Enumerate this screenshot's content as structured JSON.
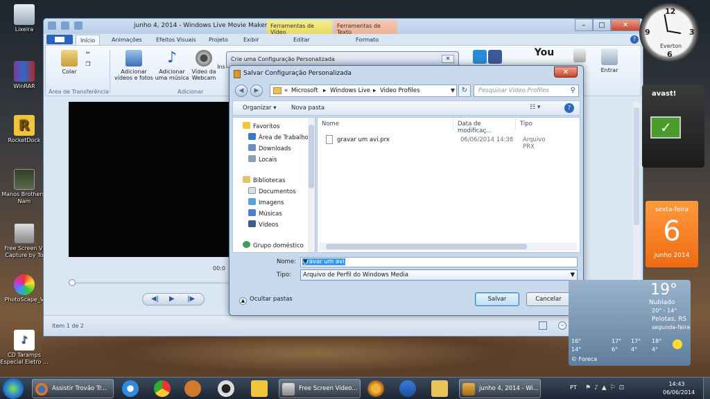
{
  "desktop_icons": [
    {
      "label": "Lixeira",
      "icon": "recycle-bin-icon"
    },
    {
      "label": "WinRAR",
      "icon": "winrar-icon"
    },
    {
      "label": "RocketDock",
      "icon": "rocketdock-icon"
    },
    {
      "label": "Manos Brothers-Nam",
      "icon": "video-thumbnail-icon"
    },
    {
      "label": "Free Screen Vi Capture by To",
      "icon": "screen-capture-icon"
    },
    {
      "label": "PhotoScape_V",
      "icon": "photoscape-icon"
    },
    {
      "label": "CD Taramps Especial Eletro ...",
      "icon": "mp3-file-icon"
    }
  ],
  "movie_maker": {
    "title": "junho 4, 2014 - Windows Live Movie Maker",
    "contextual_tabs": {
      "video_tools": "Ferramentas de Vídeo",
      "text_tools": "Ferramentas de Texto"
    },
    "tabs": [
      "Início",
      "Animações",
      "Efeitos Visuais",
      "Projeto",
      "Exibir",
      "Editar",
      "Formato"
    ],
    "ribbon": {
      "paste": "Colar",
      "clipboard_group": "Área de Transferência",
      "add_videos_photos": "Adicionar vídeos e fotos",
      "add_music": "Adicionar uma música",
      "webcam_video": "Vídeo da Webcam",
      "insert_partial": "Ins",
      "add_group": "Adicionar",
      "enter": "Entrar"
    },
    "player": {
      "time": "00:0"
    },
    "status": "Item 1 de 2"
  },
  "back_dialog": {
    "title": "Crie uma Configuração Personalizada"
  },
  "save_dialog": {
    "title": "Salvar Configuração Personalizada",
    "breadcrumbs": [
      "Microsoft",
      "Windows Live",
      "Video Profiles"
    ],
    "search_placeholder": "Pesquisar Video Profiles",
    "toolbar": {
      "organize": "Organizar ▾",
      "new_folder": "Nova pasta"
    },
    "nav": {
      "favorites": "Favoritos",
      "desktop": "Área de Trabalho",
      "downloads": "Downloads",
      "places": "Locais",
      "libraries": "Bibliotecas",
      "documents": "Documentos",
      "images": "Imagens",
      "music": "Músicas",
      "videos": "Vídeos",
      "homegroup": "Grupo doméstico"
    },
    "columns": {
      "name": "Nome",
      "date": "Data de modificaç...",
      "type": "Tipo"
    },
    "files": [
      {
        "name": "gravar um avi.prx",
        "date": "06/06/2014 14:38",
        "type": "Arquivo PRX"
      }
    ],
    "name_label": "Nome:",
    "name_value": "gravar um avi",
    "type_label": "Tipo:",
    "type_value": "Arquivo de Perfil do Windows Media",
    "hide_folders": "Ocultar pastas",
    "save_button": "Salvar",
    "cancel_button": "Cancelar"
  },
  "gadgets": {
    "clock_name": "Everton",
    "calendar": {
      "weekday": "sexta-feira",
      "day": "6",
      "month": "junho 2014"
    },
    "weather": {
      "temp": "19°",
      "condition": "Nublado",
      "range": "20° - 14°",
      "city": "Pelotas, RS",
      "day2": "segunda-feira",
      "forecast": [
        {
          "hi": "16°",
          "lo": "14°"
        },
        {
          "hi": "17°",
          "lo": "6°"
        },
        {
          "hi": "17°",
          "lo": "4°"
        },
        {
          "hi": "18°",
          "lo": "4°"
        }
      ],
      "provider": "© Foreca"
    },
    "avast_logo": "avast!"
  },
  "taskbar": {
    "tasks": [
      {
        "label": "Assistir Trovão Tr...",
        "icon": "firefox-icon"
      },
      {
        "label": "Free Screen Video...",
        "icon": "screen-capture-icon"
      },
      {
        "label": "junho 4, 2014 - Wi...",
        "icon": "movie-maker-icon"
      }
    ],
    "lang": "PT",
    "time": "14:43",
    "date": "06/06/2014"
  },
  "colors": {
    "accent": "#2f67b8",
    "calendar": "#ef6a12",
    "selection": "#3399ff"
  }
}
